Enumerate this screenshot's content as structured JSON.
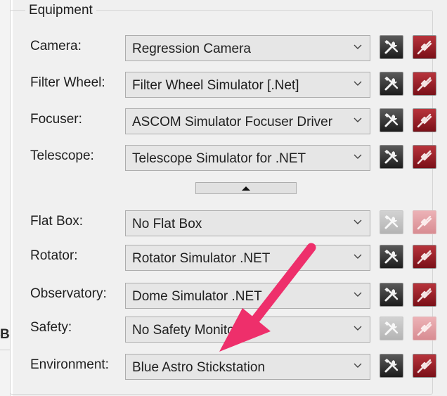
{
  "group_title": "Equipment",
  "rows": [
    {
      "label": "Camera:",
      "value": "Regression Camera",
      "enabled": true
    },
    {
      "label": "Filter Wheel:",
      "value": "Filter Wheel Simulator [.Net]",
      "enabled": true
    },
    {
      "label": "Focuser:",
      "value": "ASCOM Simulator Focuser Driver",
      "enabled": true
    },
    {
      "label": "Telescope:",
      "value": "Telescope Simulator for .NET",
      "enabled": true
    },
    {
      "label": "Flat Box:",
      "value": "No Flat Box",
      "enabled": false
    },
    {
      "label": "Rotator:",
      "value": "Rotator Simulator .NET",
      "enabled": true
    },
    {
      "label": "Observatory:",
      "value": "Dome Simulator .NET",
      "enabled": true
    },
    {
      "label": "Safety:",
      "value": "No Safety Monitor",
      "enabled": false
    },
    {
      "label": "Environment:",
      "value": "Blue Astro Stickstation",
      "enabled": true
    }
  ],
  "left_partial_label": "B",
  "icons": {
    "setup": "setup-tools-icon",
    "connect": "connect-plug-icon",
    "dropdown": "chevron-down-icon",
    "toggle": "triangle-up-icon"
  },
  "colors": {
    "setup_button": "#2e2e2e",
    "connect_button": "#9b1f27",
    "annotation_arrow": "#ee2f6b"
  }
}
